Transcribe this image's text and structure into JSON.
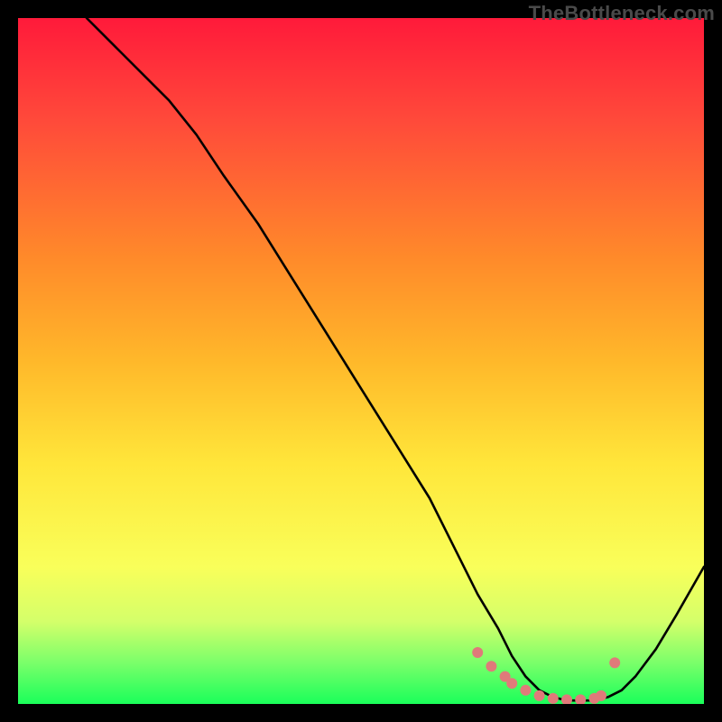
{
  "watermark": "TheBottleneck.com",
  "colors": {
    "background": "#000000",
    "curve_stroke": "#000000",
    "marker_fill": "#e07a7a",
    "gradient_top": "#ff1a3a",
    "gradient_bottom": "#1aff5a"
  },
  "chart_data": {
    "type": "line",
    "title": "",
    "xlabel": "",
    "ylabel": "",
    "xlim": [
      0,
      100
    ],
    "ylim": [
      0,
      100
    ],
    "x": [
      10,
      12,
      15,
      18,
      22,
      26,
      30,
      35,
      40,
      45,
      50,
      55,
      60,
      64,
      67,
      70,
      72,
      74,
      76,
      78,
      80,
      82,
      84,
      86,
      88,
      90,
      93,
      96,
      100
    ],
    "values": [
      100,
      98,
      95,
      92,
      88,
      83,
      77,
      70,
      62,
      54,
      46,
      38,
      30,
      22,
      16,
      11,
      7,
      4,
      2,
      1,
      0.5,
      0.5,
      0.5,
      1,
      2,
      4,
      8,
      13,
      20
    ],
    "markers": {
      "x": [
        67,
        69,
        71,
        72,
        74,
        76,
        78,
        80,
        82,
        84,
        85,
        87
      ],
      "y": [
        7.5,
        5.5,
        4,
        3,
        2,
        1.2,
        0.8,
        0.6,
        0.6,
        0.8,
        1.2,
        6
      ],
      "size": 6
    },
    "description": "U-shaped bottleneck curve descending steeply from upper-left, flattening near x≈80 (bottleneck minimum), then rising again toward the right edge. Salmon-colored markers highlight the trough region."
  }
}
